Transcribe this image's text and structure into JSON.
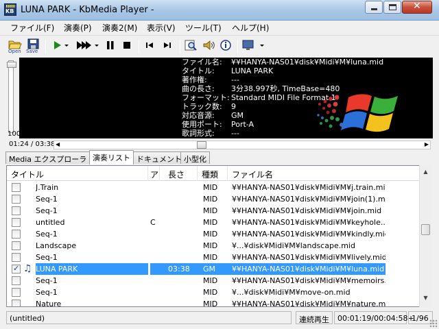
{
  "window": {
    "title": "LUNA PARK - KbMedia Player -"
  },
  "menu": [
    "ファイル(F)",
    "演奏(P)",
    "演奏2(M)",
    "表示(V)",
    "ツール(T)",
    "ヘルプ(H)"
  ],
  "toolbar": {
    "open_label": "Open",
    "save_label": "Save"
  },
  "info": [
    {
      "key": "ファイル名:",
      "value": "¥¥HANYA-NAS01¥disk¥Midi¥M¥luna.mid"
    },
    {
      "key": "タイトル:",
      "value": "LUNA PARK"
    },
    {
      "key": "著作権:",
      "value": "---"
    },
    {
      "key": "曲の長さ:",
      "value": "3分38.997秒, TimeBase=480"
    },
    {
      "key": "フォーマット:",
      "value": "Standard MIDI File Format 1"
    },
    {
      "key": "トラック数:",
      "value": "9"
    },
    {
      "key": "対応音源:",
      "value": "GM"
    },
    {
      "key": "使用ポート:",
      "value": "Port-A"
    },
    {
      "key": "歌詞形式:",
      "value": "---"
    }
  ],
  "volume": {
    "value": "100"
  },
  "playback": {
    "time": "01:24 / 03:38",
    "position_fraction": 0.385
  },
  "tabs": [
    "Media エクスプローラ",
    "演奏リスト",
    "ドキュメント",
    "小型化"
  ],
  "playlist": {
    "columns": [
      "タイトル",
      "ア",
      "長さ",
      "種類",
      "ファイル名"
    ],
    "rows": [
      {
        "checked": false,
        "playing": false,
        "title": "J.Train",
        "artist": "",
        "length": "",
        "type": "MID",
        "file": "¥¥HANYA-NAS01¥disk¥Midi¥M¥j.train.mid"
      },
      {
        "checked": false,
        "playing": false,
        "title": "Seq-1",
        "artist": "",
        "length": "",
        "type": "MID",
        "file": "¥¥HANYA-NAS01¥disk¥Midi¥M¥join(1).m..."
      },
      {
        "checked": false,
        "playing": false,
        "title": "Seq-1",
        "artist": "",
        "length": "",
        "type": "MID",
        "file": "¥¥HANYA-NAS01¥disk¥Midi¥M¥join.mid"
      },
      {
        "checked": false,
        "playing": false,
        "title": "untitled",
        "artist": "C",
        "length": "",
        "type": "MID",
        "file": "¥¥HANYA-NAS01¥disk¥Midi¥M¥keyhole..."
      },
      {
        "checked": false,
        "playing": false,
        "title": "Seq-1",
        "artist": "",
        "length": "",
        "type": "MID",
        "file": "¥¥HANYA-NAS01¥disk¥Midi¥M¥kindly.mid"
      },
      {
        "checked": false,
        "playing": false,
        "title": "Landscape",
        "artist": "",
        "length": "",
        "type": "MID",
        "file": "¥...¥disk¥Midi¥M¥landscape.mid"
      },
      {
        "checked": false,
        "playing": false,
        "title": "Seq-1",
        "artist": "",
        "length": "",
        "type": "MID",
        "file": "¥¥HANYA-NAS01¥disk¥Midi¥M¥lively.mid"
      },
      {
        "checked": true,
        "playing": true,
        "title": "LUNA PARK",
        "artist": "",
        "length": "03:38",
        "type": "GM",
        "file": "¥¥HANYA-NAS01¥disk¥Midi¥M¥luna.mid"
      },
      {
        "checked": false,
        "playing": false,
        "title": "Seq-1",
        "artist": "",
        "length": "",
        "type": "MID",
        "file": "¥¥HANYA-NAS01¥disk¥Midi¥M¥memoirs..."
      },
      {
        "checked": false,
        "playing": false,
        "title": "Seq-1",
        "artist": "",
        "length": "",
        "type": "MID",
        "file": "¥...¥disk¥Midi¥M¥move-on.mid"
      },
      {
        "checked": false,
        "playing": false,
        "title": "Nature",
        "artist": "",
        "length": "",
        "type": "MID",
        "file": "¥¥HANYA-NAS01¥disk¥Midi¥M¥nature.m..."
      }
    ]
  },
  "status": {
    "left": "(untitled)",
    "mode": "連続再生",
    "time": "00:01:19/00:04:58+",
    "index": "1/96"
  },
  "colors": {
    "selection": "#3399ff",
    "video_bg": "#000000"
  }
}
